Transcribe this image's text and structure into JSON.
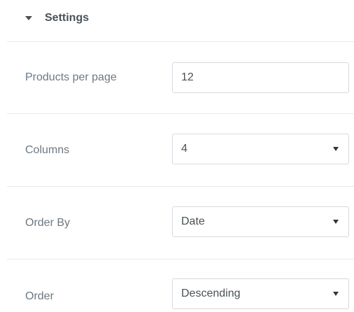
{
  "section": {
    "title": "Settings"
  },
  "fields": {
    "products_per_page": {
      "label": "Products per page",
      "value": "12"
    },
    "columns": {
      "label": "Columns",
      "value": "4"
    },
    "order_by": {
      "label": "Order By",
      "value": "Date"
    },
    "order": {
      "label": "Order",
      "value": "Descending"
    }
  }
}
